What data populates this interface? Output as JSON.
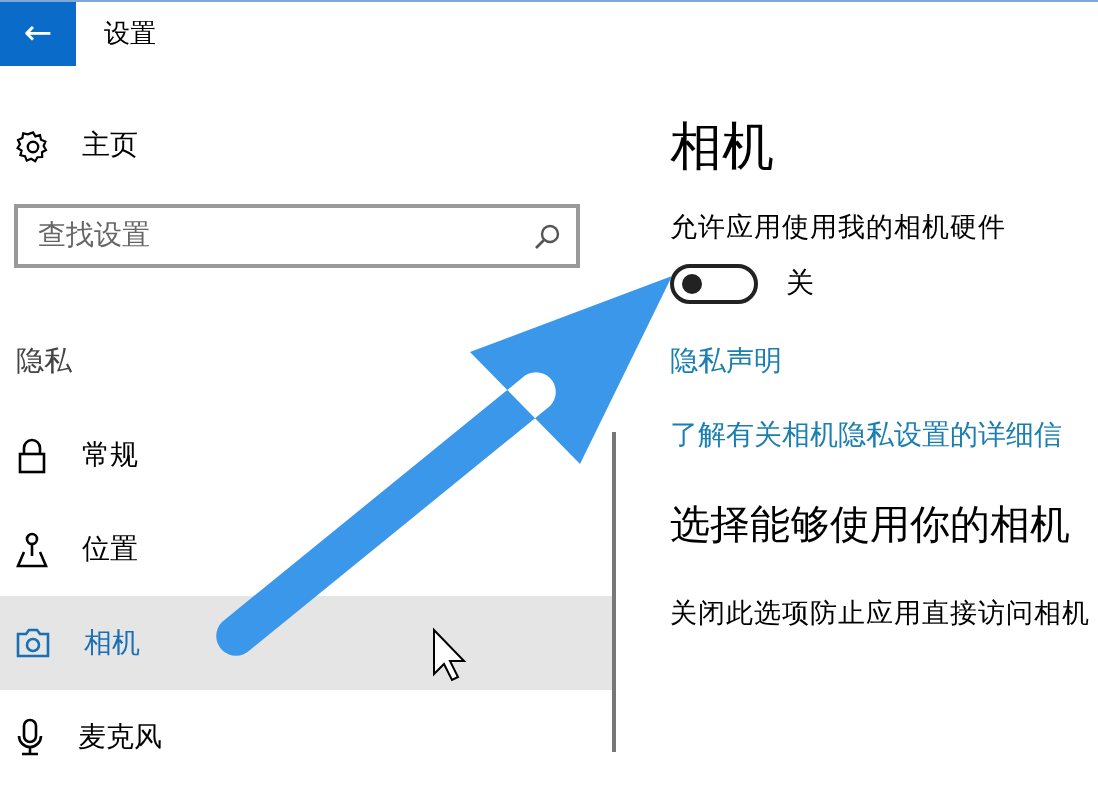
{
  "window": {
    "title": "设置",
    "back_icon": "←"
  },
  "sidebar": {
    "home": "主页",
    "search": {
      "placeholder": "查找设置"
    },
    "section": "隐私",
    "items": [
      {
        "label": "常规",
        "kind": "lock",
        "selected": false
      },
      {
        "label": "位置",
        "kind": "location",
        "selected": false
      },
      {
        "label": "相机",
        "kind": "camera",
        "selected": true
      },
      {
        "label": "麦克风",
        "kind": "mic",
        "selected": false
      }
    ]
  },
  "content": {
    "title": "相机",
    "setting_label": "允许应用使用我的相机硬件",
    "toggle": {
      "on": false,
      "state_label": "关"
    },
    "privacy_link": "隐私声明",
    "learn_more_link": "了解有关相机隐私设置的详细信",
    "section_heading": "选择能够使用你的相机",
    "description": "关闭此选项防止应用直接访问相机"
  }
}
